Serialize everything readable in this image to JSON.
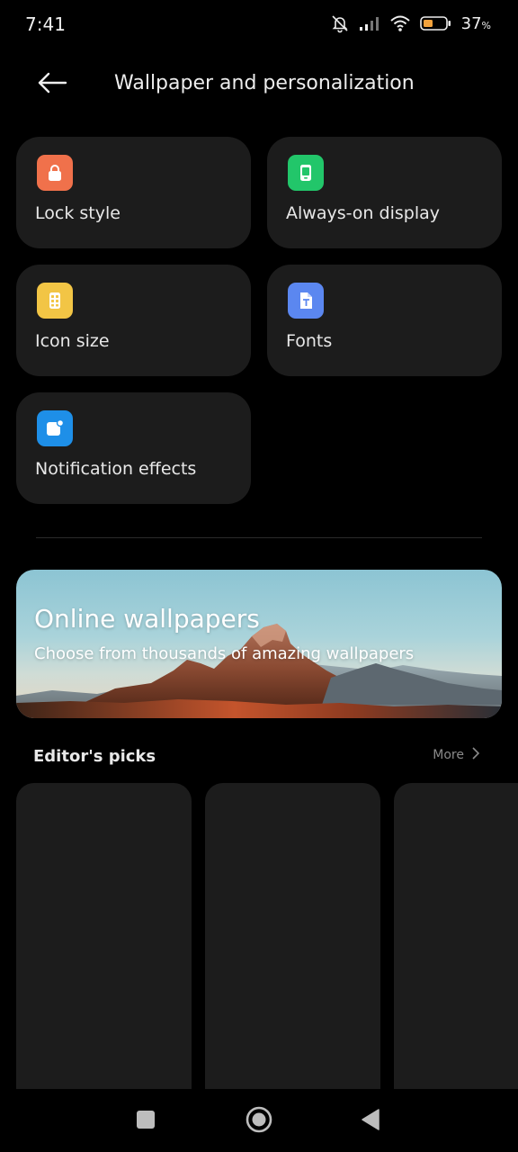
{
  "status_bar": {
    "time": "7:41",
    "battery_percent": "37",
    "battery_unit": "%"
  },
  "header": {
    "title": "Wallpaper and personalization"
  },
  "tiles": [
    {
      "label": "Lock style",
      "icon": "lock-icon",
      "color": "#f0714b"
    },
    {
      "label": "Always-on display",
      "icon": "always-on-display-icon",
      "color": "#22c66a"
    },
    {
      "label": "Icon size",
      "icon": "icon-size-icon",
      "color": "#f2c545"
    },
    {
      "label": "Fonts",
      "icon": "fonts-icon",
      "color": "#5b87f0"
    },
    {
      "label": "Notification effects",
      "icon": "notification-icon",
      "color": "#1e8fe8"
    }
  ],
  "banner": {
    "title": "Online wallpapers",
    "subtitle": "Choose from thousands of amazing wallpapers"
  },
  "editors_picks": {
    "title": "Editor's picks",
    "more_label": "More"
  },
  "colors": {
    "background": "#000000",
    "surface": "#1c1c1c"
  }
}
